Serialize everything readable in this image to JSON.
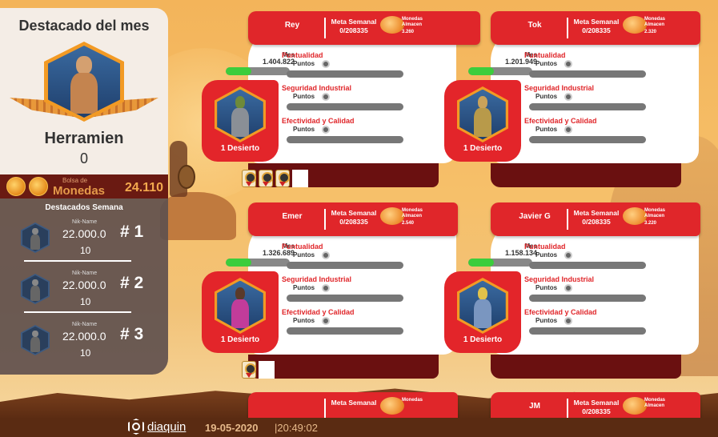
{
  "destacado_mes": {
    "title": "Destacado del mes",
    "name": "Herramien",
    "score": "0"
  },
  "bolsa": {
    "label_small": "Bolsa de",
    "label_big": "Monedas",
    "value": "24.110"
  },
  "semana": {
    "title": "Destacados Semana",
    "rows": [
      {
        "nik": "Nik-Name",
        "points": "22.000.0",
        "rank": "# 1",
        "small": "10"
      },
      {
        "nik": "Nik-Name",
        "points": "22.000.0",
        "rank": "# 2",
        "small": "10"
      },
      {
        "nik": "Nik-Name",
        "points": "22.000.0",
        "rank": "# 3",
        "small": "10"
      }
    ]
  },
  "cards": [
    {
      "name": "Rey",
      "meta_label": "Meta Semanal",
      "meta_value": "0/208335",
      "monedas_label": "Monedas Almacen",
      "monedas_value": "3.260",
      "mes_label": "Mes",
      "mes_value": "1.404.822",
      "mes_progress": 0.4,
      "avatar_label": "1 Desierto",
      "criteria": [
        "Puntualidad",
        "Seguridad Industrial",
        "Efectividad y Calidad"
      ],
      "puntos_label": "Puntos",
      "medals": 3
    },
    {
      "name": "Tok",
      "meta_label": "Meta Semanal",
      "meta_value": "0/208335",
      "monedas_label": "Monedas Almacen",
      "monedas_value": "2.320",
      "mes_label": "Mes",
      "mes_value": "1.201.949",
      "mes_progress": 0.4,
      "avatar_label": "1 Desierto",
      "criteria": [
        "Puntualidad",
        "Seguridad Industrial",
        "Efectividad y Calidad"
      ],
      "puntos_label": "Puntos",
      "medals": 0
    },
    {
      "name": "Emer",
      "meta_label": "Meta Semanal",
      "meta_value": "0/208335",
      "monedas_label": "Monedas Almacen",
      "monedas_value": "2.540",
      "mes_label": "Mes",
      "mes_value": "1.326.689",
      "mes_progress": 0.4,
      "avatar_label": "1 Desierto",
      "criteria": [
        "Puntualidad",
        "Seguridad Industrial",
        "Efectividad y Calidad"
      ],
      "puntos_label": "Puntos",
      "medals": 1
    },
    {
      "name": "Javier G",
      "meta_label": "Meta Semanal",
      "meta_value": "0/208335",
      "monedas_label": "Monedas Almacen",
      "monedas_value": "3.220",
      "mes_label": "Mes",
      "mes_value": "1.158.134",
      "mes_progress": 0.4,
      "avatar_label": "1 Desierto",
      "criteria": [
        "Puntualidad",
        "Seguridad Industrial",
        "Efectividad y Calidad"
      ],
      "puntos_label": "Puntos",
      "medals": 0
    }
  ],
  "partial_cards": [
    {
      "name": "",
      "meta_label": "Meta Semanal",
      "monedas_label": "Monedas"
    },
    {
      "name": "JM",
      "meta_label": "Meta Semanal",
      "meta_value": "0/208335",
      "monedas_label": "Monedas Almacen"
    }
  ],
  "footer": {
    "brand": "diaquin",
    "date": "19-05-2020",
    "time": "|20:49:02"
  },
  "colors": {
    "accent": "#e0262a",
    "dark_red": "#6a1010",
    "progress": "#3ccd3c"
  },
  "icons": [
    "hero-avatar-icon",
    "coin-icon",
    "medal-icon",
    "diaquin-logo-icon"
  ]
}
